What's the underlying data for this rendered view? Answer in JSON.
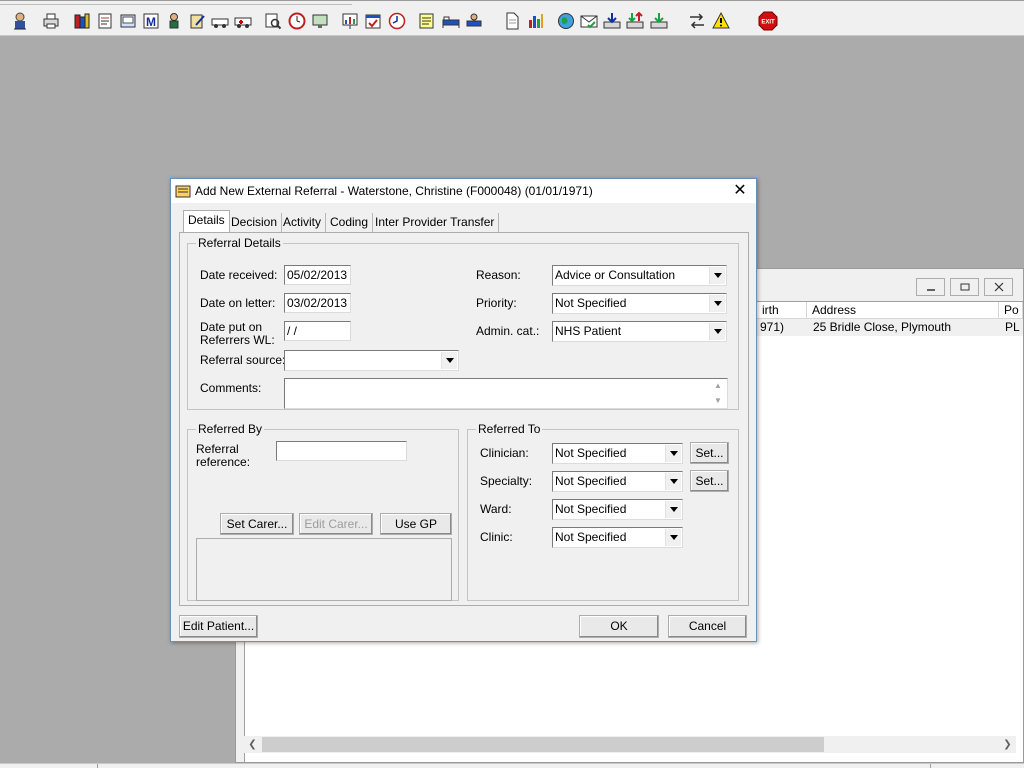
{
  "toolbar": {
    "icons": [
      "person-search-icon",
      "printer-icon",
      "books-icon",
      "notepad-icon",
      "document-view-icon",
      "letter-m-icon",
      "patient-icon",
      "clipboard-edit-icon",
      "vehicle-icon",
      "ambulance-icon",
      "search-doc-icon",
      "clock-icon",
      "monitor-icon",
      "chart-board-icon",
      "calendar-check-icon",
      "clock-refresh-icon",
      "notes-icon",
      "bed-icon",
      "ward-icon",
      "page-icon",
      "bar-chart-icon",
      "globe-icon",
      "envelope-check-icon",
      "tray-down-icon",
      "tray-exchange-icon",
      "transfer-arrows-icon",
      "warning-icon",
      "exit-icon"
    ],
    "exit_label": "EXIT"
  },
  "background_window": {
    "columns": [
      "irth",
      "Address",
      "Po"
    ],
    "row": [
      "971)",
      "25 Bridle Close, Plymouth",
      "PL"
    ]
  },
  "dialog": {
    "title": "Add New External Referral - Waterstone, Christine (F000048) (01/01/1971)",
    "tabs": [
      "Details",
      "Decision",
      "Activity",
      "Coding",
      "Inter Provider Transfer"
    ],
    "active_tab": "Details",
    "referral_details": {
      "group_label": "Referral Details",
      "date_received_label": "Date received:",
      "date_received": "05/02/2013",
      "date_on_letter_label": "Date on letter:",
      "date_on_letter": "03/02/2013",
      "date_put_on_wl_label_1": "Date put on",
      "date_put_on_wl_label_2": "Referrers WL:",
      "date_put_on_wl": " /  /",
      "referral_source_label": "Referral source:",
      "referral_source": "",
      "comments_label": "Comments:",
      "comments": "",
      "reason_label": "Reason:",
      "reason": "Advice or Consultation",
      "priority_label": "Priority:",
      "priority": "Not Specified",
      "admin_cat_label": "Admin. cat.:",
      "admin_cat": "NHS Patient"
    },
    "referred_by": {
      "group_label": "Referred By",
      "referral_reference_label_1": "Referral",
      "referral_reference_label_2": "reference:",
      "referral_reference": "",
      "set_carer_label": "Set Carer...",
      "edit_carer_label": "Edit Carer...",
      "use_gp_label": "Use GP"
    },
    "referred_to": {
      "group_label": "Referred To",
      "clinician_label": "Clinician:",
      "clinician": "Not Specified",
      "specialty_label": "Specialty:",
      "specialty": "Not Specified",
      "ward_label": "Ward:",
      "ward": "Not Specified",
      "clinic_label": "Clinic:",
      "clinic": "Not Specified",
      "set_label": "Set..."
    },
    "edit_patient_label": "Edit Patient...",
    "ok_label": "OK",
    "cancel_label": "Cancel"
  }
}
